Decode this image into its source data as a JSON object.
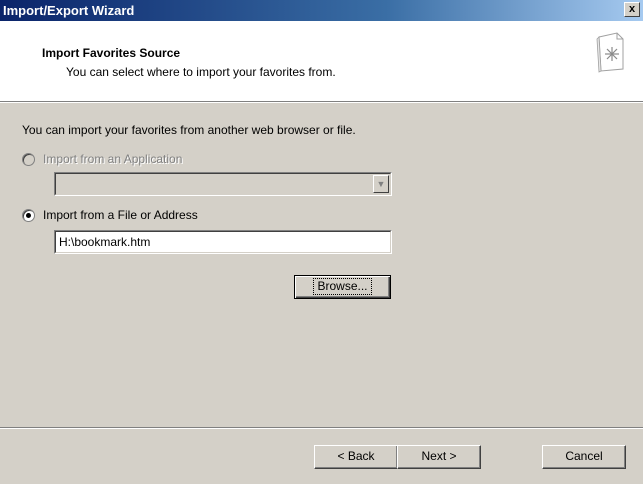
{
  "window": {
    "title": "Import/Export Wizard",
    "close_label": "x"
  },
  "header": {
    "title": "Import Favorites Source",
    "subtitle": "You can select where to import your favorites from.",
    "icon": "favorites-document-icon"
  },
  "body": {
    "intro": "You can import your favorites from another web browser or file.",
    "option_application": {
      "label": "Import from an Application",
      "selected": false,
      "enabled": false,
      "combo_value": ""
    },
    "option_file": {
      "label": "Import from a File or Address",
      "selected": true,
      "enabled": true,
      "path_value": "H:\\bookmark.htm"
    },
    "browse_label": "Browse..."
  },
  "footer": {
    "back_label": "< Back",
    "next_label": "Next >",
    "cancel_label": "Cancel"
  },
  "colors": {
    "titlebar_start": "#0a246a",
    "titlebar_end": "#a6caf0",
    "face": "#d4d0c8"
  }
}
